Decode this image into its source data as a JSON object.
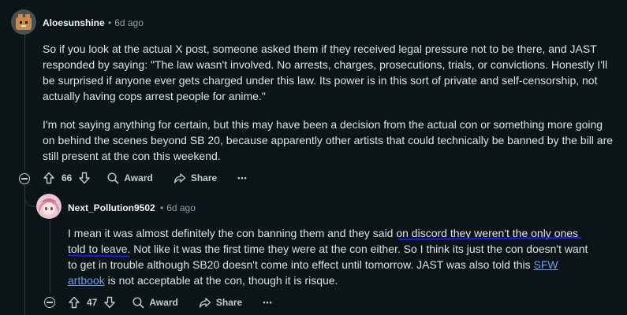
{
  "comments": [
    {
      "username": "Aloesunshine",
      "separator": "•",
      "time": "6d ago",
      "paragraphs": [
        "So if you look at the actual X post, someone asked them if they received legal pressure not to be there, and JAST responded by saying: \"The law wasn't involved. No arrests, charges, prosecutions, trials, or convictions. Honestly I'll be surprised if anyone ever gets charged under this law. Its power is in this sort of private and self-censorship, not actually having cops arrest people for anime.\"",
        "I'm not saying anything for certain, but this may have been a decision from the actual con or something more going on behind the scenes beyond SB 20, because apparently other artists that could technically be banned by the bill are still present at the con this weekend."
      ],
      "votes": "66",
      "award_label": "Award",
      "share_label": "Share",
      "more_label": "•••"
    },
    {
      "username": "Next_Pollution9502",
      "separator": "•",
      "time": "6d ago",
      "text_before": "I mean it was almost definitely the con banning them and they said on discord they weren't the only ones told to leave. Not like it was the first time they were at the con either. So I think its just the con doesn't want to get in trouble although SB20 doesn't come into effect until tomorrow. JAST was also told this ",
      "link_text": "SFW artbook",
      "text_after": " is not acceptable at the con, though it is risque.",
      "votes": "47",
      "award_label": "Award",
      "share_label": "Share",
      "more_label": "•••"
    }
  ],
  "colors": {
    "background": "#0b1416",
    "link": "#6a9bf4",
    "annotation": "#1a1aff"
  },
  "icons": [
    "upvote-icon",
    "downvote-icon",
    "award-icon",
    "share-icon",
    "collapse-icon"
  ]
}
